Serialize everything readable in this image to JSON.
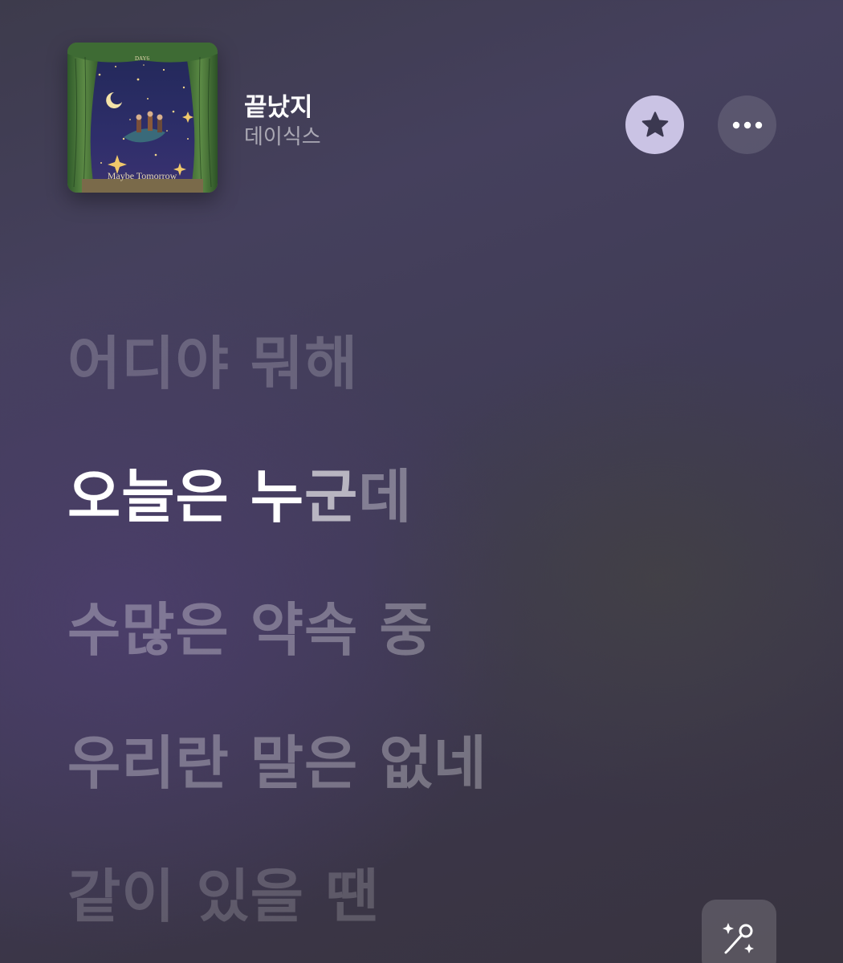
{
  "now_playing": {
    "album": {
      "artist_mark": "DAY6",
      "title": "Maybe Tomorrow",
      "icon": "album-artwork"
    },
    "title": "끝났지",
    "artist": "데이식스"
  },
  "actions": {
    "favorite_icon": "star-icon",
    "more_icon": "ellipsis-icon",
    "sing_icon": "microphone-sparkles-icon"
  },
  "lyrics": {
    "line_1": "어디야 뭐해",
    "active_line": {
      "sung": "오늘은 누",
      "fading": "군",
      "unsung": "데"
    },
    "line_3": "수많은 약속 중",
    "line_4": "우리란 말은 없네",
    "line_5": "같이 있을 땐"
  },
  "colors": {
    "favorite_button": "#cac3e4",
    "favorite_star": "#3b3850",
    "active_lyric": "#ffffff",
    "background": "#3f3b54"
  }
}
